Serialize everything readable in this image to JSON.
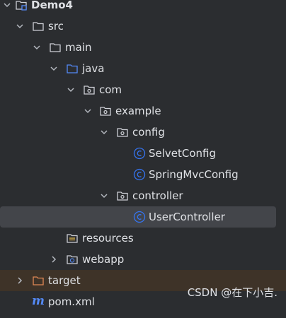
{
  "tree": {
    "items": [
      {
        "label": "Demo4",
        "icon": "module-folder-icon",
        "expanded": true
      },
      {
        "label": "src",
        "icon": "folder-icon",
        "expanded": true
      },
      {
        "label": "main",
        "icon": "folder-icon",
        "expanded": true
      },
      {
        "label": "java",
        "icon": "source-root-folder-icon",
        "expanded": true
      },
      {
        "label": "com",
        "icon": "package-icon",
        "expanded": true
      },
      {
        "label": "example",
        "icon": "package-icon",
        "expanded": true
      },
      {
        "label": "config",
        "icon": "package-icon",
        "expanded": true
      },
      {
        "label": "SelvetConfig",
        "icon": "java-class-icon"
      },
      {
        "label": "SpringMvcConfig",
        "icon": "java-class-icon"
      },
      {
        "label": "controller",
        "icon": "package-icon",
        "expanded": true
      },
      {
        "label": "UserController",
        "icon": "java-class-icon",
        "selected": true
      },
      {
        "label": "resources",
        "icon": "resources-folder-icon"
      },
      {
        "label": "webapp",
        "icon": "web-folder-icon",
        "expanded": false
      },
      {
        "label": "target",
        "icon": "excluded-folder-icon",
        "expanded": false
      },
      {
        "label": "pom.xml",
        "icon": "maven-icon"
      }
    ]
  },
  "colors": {
    "background": "#2b2d30",
    "selected_row": "#43454a",
    "excluded_row": "#3e3328",
    "text": "#dfe1e5",
    "class_icon": "#3574f0",
    "source_root": "#548af7",
    "excluded_folder": "#e08855"
  },
  "watermark": {
    "text": "CSDN @在下小吉."
  }
}
